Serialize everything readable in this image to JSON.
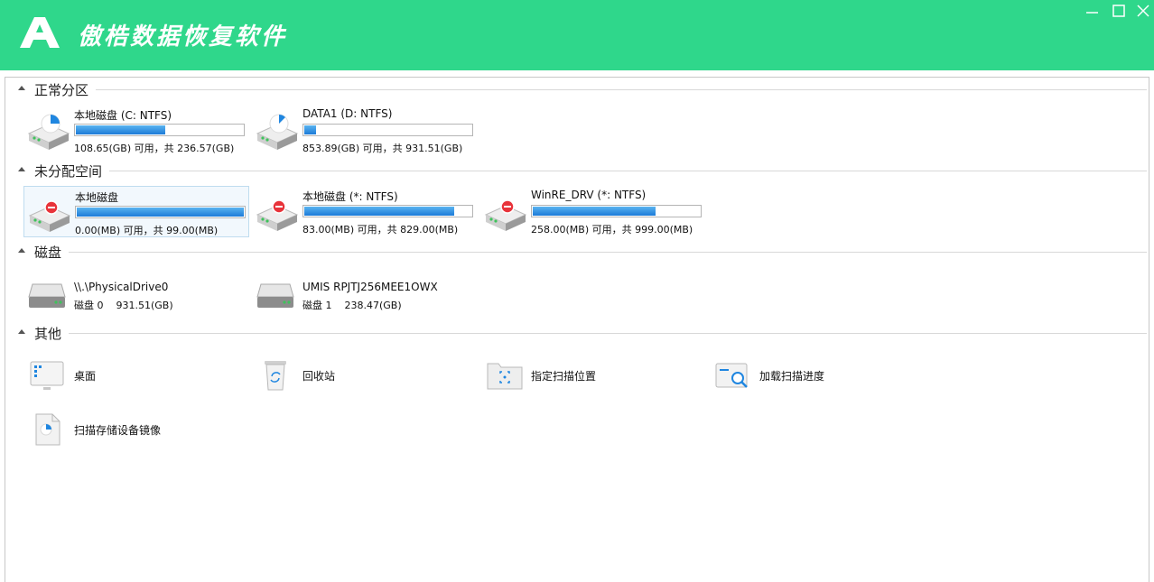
{
  "app": {
    "title": "傲梏数据恢复软件",
    "logo_letter": "A"
  },
  "colors": {
    "titlebar": "#2fd78b",
    "bar_fill": "#1d7bd8"
  },
  "window_controls": [
    "minimize-icon",
    "maximize-icon",
    "close-icon"
  ],
  "sections": {
    "normal": "正常分区",
    "unallocated": "未分配空间",
    "disks": "磁盘",
    "other": "其他"
  },
  "normal_partitions": [
    {
      "name": "本地磁盘 (C: NTFS)",
      "info": "108.65(GB) 可用，共 236.57(GB)",
      "fill_fraction": 0.54,
      "icon": "pie-chart-drive-icon"
    },
    {
      "name": "DATA1 (D: NTFS)",
      "info": "853.89(GB) 可用，共 931.51(GB)",
      "fill_fraction": 0.08,
      "icon": "pie-chart-drive-icon"
    }
  ],
  "unallocated_partitions": [
    {
      "name": "本地磁盘",
      "info": "0.00(MB) 可用，共 99.00(MB)",
      "fill_fraction": 1.0,
      "icon": "error-drive-icon"
    },
    {
      "name": "本地磁盘 (*: NTFS)",
      "info": "83.00(MB) 可用，共 829.00(MB)",
      "fill_fraction": 0.9,
      "icon": "error-drive-icon"
    },
    {
      "name": "WinRE_DRV (*: NTFS)",
      "info": "258.00(MB) 可用，共 999.00(MB)",
      "fill_fraction": 0.74,
      "icon": "error-drive-icon"
    }
  ],
  "disks": [
    {
      "name": "\\\\.\\PhysicalDrive0",
      "label": "磁盘 0",
      "size": "931.51(GB)",
      "icon": "hard-disk-icon"
    },
    {
      "name": "UMIS RPJTJ256MEE1OWX",
      "label": "磁盘 1",
      "size": "238.47(GB)",
      "icon": "hard-disk-icon"
    }
  ],
  "other_items": [
    {
      "name": "桌面",
      "icon": "desktop-icon"
    },
    {
      "name": "回收站",
      "icon": "recycle-bin-icon"
    },
    {
      "name": "指定扫描位置",
      "icon": "scan-folder-icon"
    },
    {
      "name": "加载扫描进度",
      "icon": "load-progress-icon"
    },
    {
      "name": "扫描存储设备镜像",
      "icon": "disk-image-icon"
    }
  ]
}
